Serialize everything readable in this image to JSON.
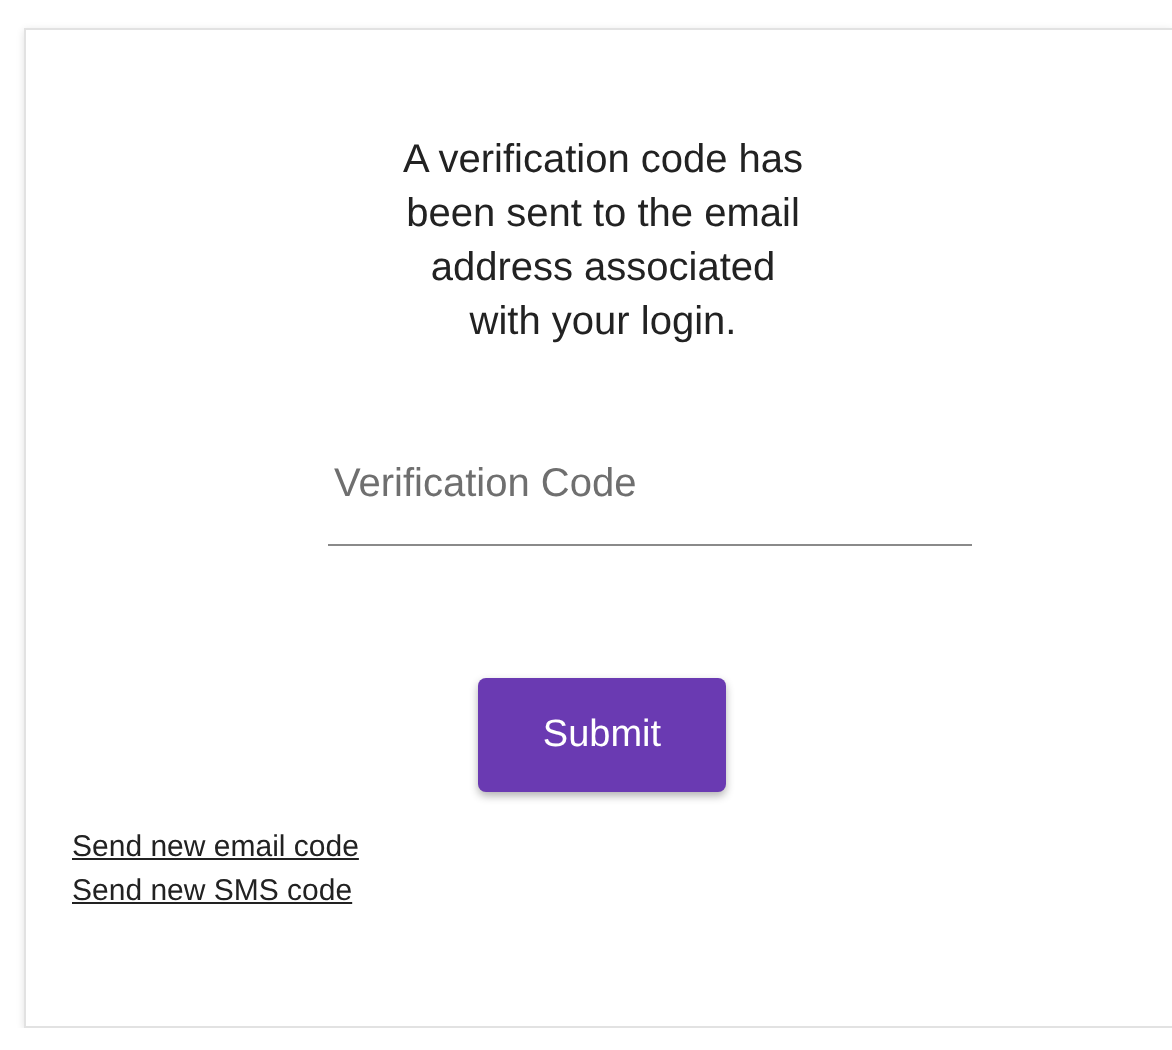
{
  "message": "A verification code has been sent to the email address associated with your login.",
  "code_field": {
    "placeholder": "Verification Code"
  },
  "submit_button": "Submit",
  "links": [
    "Send new email code",
    "Send new SMS code"
  ]
}
